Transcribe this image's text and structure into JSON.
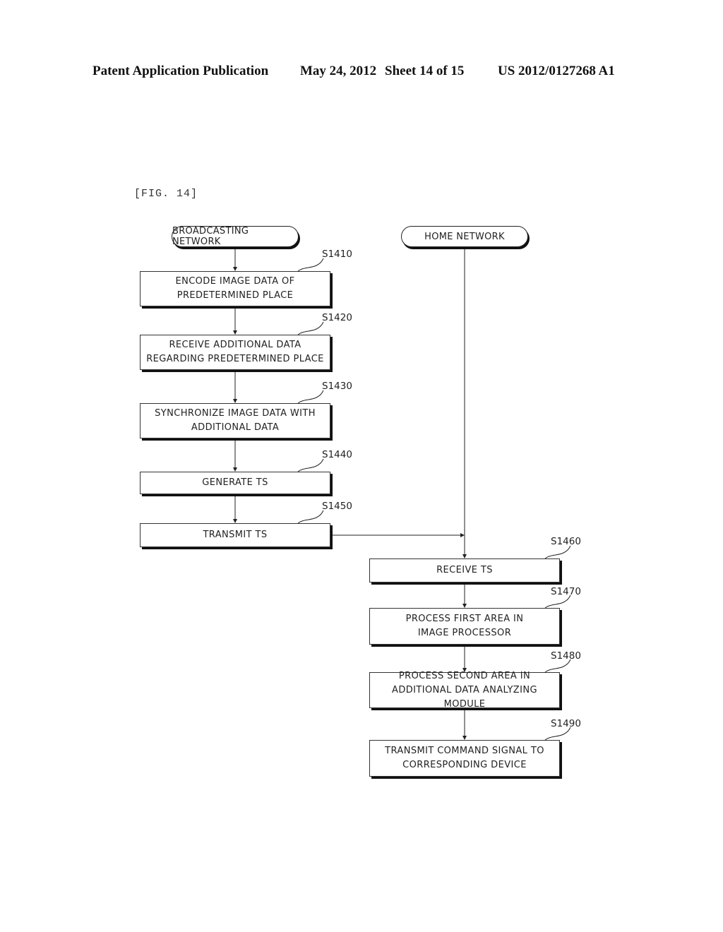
{
  "header": {
    "publication": "Patent Application Publication",
    "date": "May 24, 2012",
    "sheet": "Sheet 14 of 15",
    "number": "US 2012/0127268 A1"
  },
  "figure_label": "[FIG. 14]",
  "terminals": {
    "left": "BROADCASTING NETWORK",
    "right": "HOME NETWORK"
  },
  "steps": [
    {
      "id": "S1410",
      "text": "ENCODE IMAGE DATA OF\nPREDETERMINED PLACE",
      "lane": "broadcasting"
    },
    {
      "id": "S1420",
      "text": "RECEIVE ADDITIONAL DATA\nREGARDING PREDETERMINED PLACE",
      "lane": "broadcasting"
    },
    {
      "id": "S1430",
      "text": "SYNCHRONIZE IMAGE DATA WITH\nADDITIONAL DATA",
      "lane": "broadcasting"
    },
    {
      "id": "S1440",
      "text": "GENERATE TS",
      "lane": "broadcasting"
    },
    {
      "id": "S1450",
      "text": "TRANSMIT TS",
      "lane": "broadcasting"
    },
    {
      "id": "S1460",
      "text": "RECEIVE TS",
      "lane": "home"
    },
    {
      "id": "S1470",
      "text": "PROCESS FIRST AREA IN\nIMAGE PROCESSOR",
      "lane": "home"
    },
    {
      "id": "S1480",
      "text": "PROCESS SECOND AREA IN\nADDITIONAL DATA ANALYZING MODULE",
      "lane": "home"
    },
    {
      "id": "S1490",
      "text": "TRANSMIT COMMAND SIGNAL TO\nCORRESPONDING DEVICE",
      "lane": "home"
    }
  ]
}
